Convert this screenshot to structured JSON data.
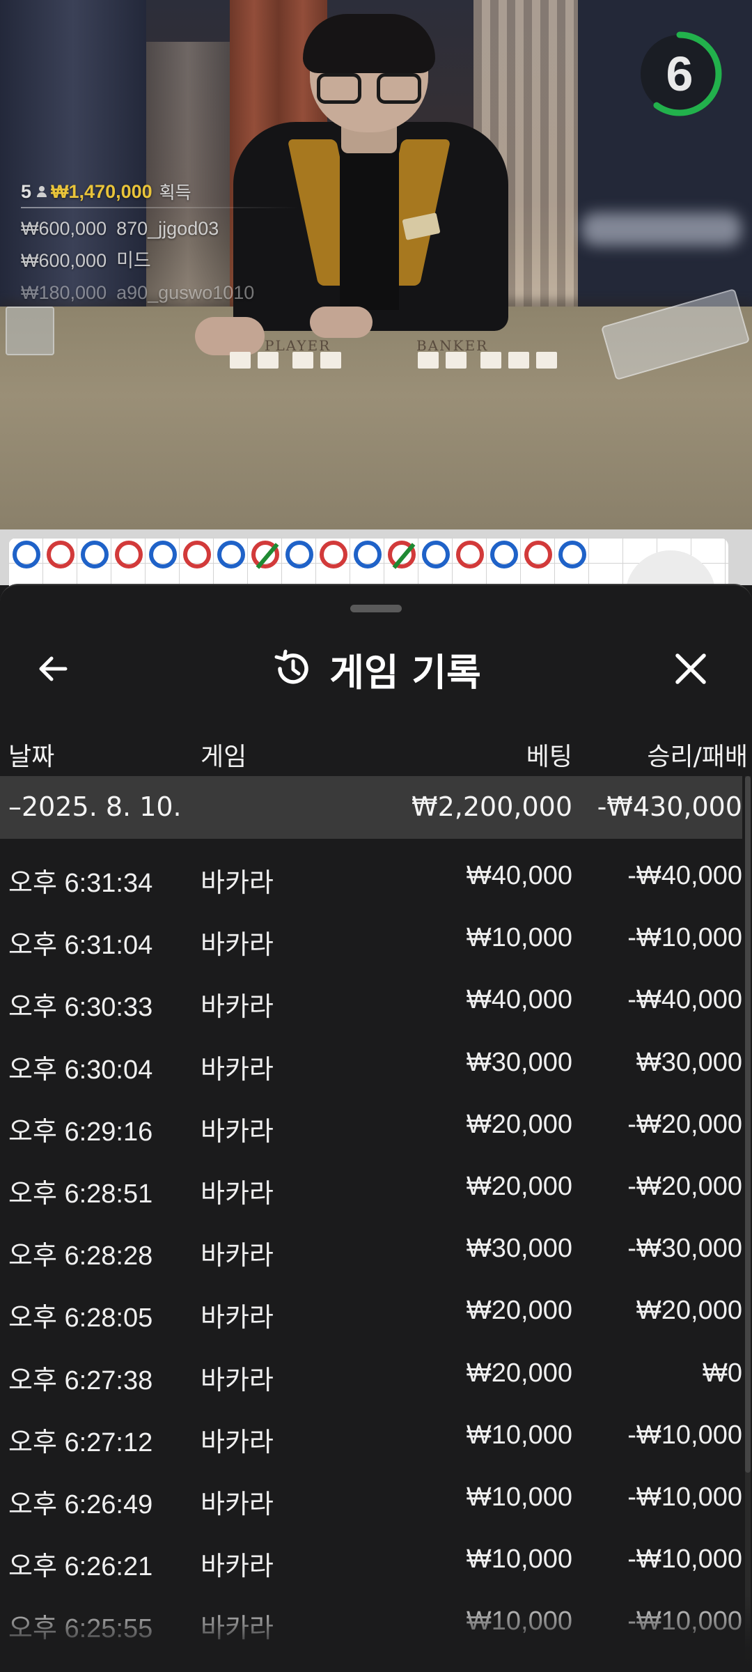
{
  "video": {
    "timer_value": "6",
    "timer_fraction": 0.6,
    "timer_color": "#22b14c",
    "table_labels": {
      "player": "PLAYER",
      "banker": "BANKER"
    },
    "winners": {
      "count": "5",
      "total": "₩1,470,000",
      "suffix": "획득",
      "rows": [
        {
          "amount": "₩600,000",
          "name": "870_jjgod03"
        },
        {
          "amount": "₩600,000",
          "name": "미드"
        },
        {
          "amount": "₩180,000",
          "name": "a90_guswo1010"
        }
      ]
    }
  },
  "roadmap": {
    "player_color": "#1f62c8",
    "banker_color": "#d23a3a",
    "tie_color": "#1f8a33",
    "beads": [
      "P",
      "B",
      "P",
      "B",
      "P",
      "B",
      "P",
      "BT",
      "P",
      "B",
      "P",
      "BT",
      "P",
      "B",
      "P",
      "B",
      "P"
    ]
  },
  "sheet": {
    "title": "게임 기록",
    "back_icon": "arrow-left-icon",
    "history_icon": "history-clock-icon",
    "close_icon": "close-x-icon",
    "columns": {
      "date": "날짜",
      "game": "게임",
      "bet": "베팅",
      "result": "승리/패배"
    },
    "day": {
      "label": "–2025. 8. 10.",
      "bet": "₩2,200,000",
      "result": "-₩430,000"
    },
    "rows": [
      {
        "time": "오후 6:31:34",
        "game": "바카라",
        "bet": "₩40,000",
        "result": "-₩40,000"
      },
      {
        "time": "오후 6:31:04",
        "game": "바카라",
        "bet": "₩10,000",
        "result": "-₩10,000"
      },
      {
        "time": "오후 6:30:33",
        "game": "바카라",
        "bet": "₩40,000",
        "result": "-₩40,000"
      },
      {
        "time": "오후 6:30:04",
        "game": "바카라",
        "bet": "₩30,000",
        "result": "₩30,000"
      },
      {
        "time": "오후 6:29:16",
        "game": "바카라",
        "bet": "₩20,000",
        "result": "-₩20,000"
      },
      {
        "time": "오후 6:28:51",
        "game": "바카라",
        "bet": "₩20,000",
        "result": "-₩20,000"
      },
      {
        "time": "오후 6:28:28",
        "game": "바카라",
        "bet": "₩30,000",
        "result": "-₩30,000"
      },
      {
        "time": "오후 6:28:05",
        "game": "바카라",
        "bet": "₩20,000",
        "result": "₩20,000"
      },
      {
        "time": "오후 6:27:38",
        "game": "바카라",
        "bet": "₩20,000",
        "result": "₩0"
      },
      {
        "time": "오후 6:27:12",
        "game": "바카라",
        "bet": "₩10,000",
        "result": "-₩10,000"
      },
      {
        "time": "오후 6:26:49",
        "game": "바카라",
        "bet": "₩10,000",
        "result": "-₩10,000"
      },
      {
        "time": "오후 6:26:21",
        "game": "바카라",
        "bet": "₩10,000",
        "result": "-₩10,000"
      },
      {
        "time": "오후 6:25:55",
        "game": "바카라",
        "bet": "₩10,000",
        "result": "-₩10,000"
      }
    ]
  }
}
